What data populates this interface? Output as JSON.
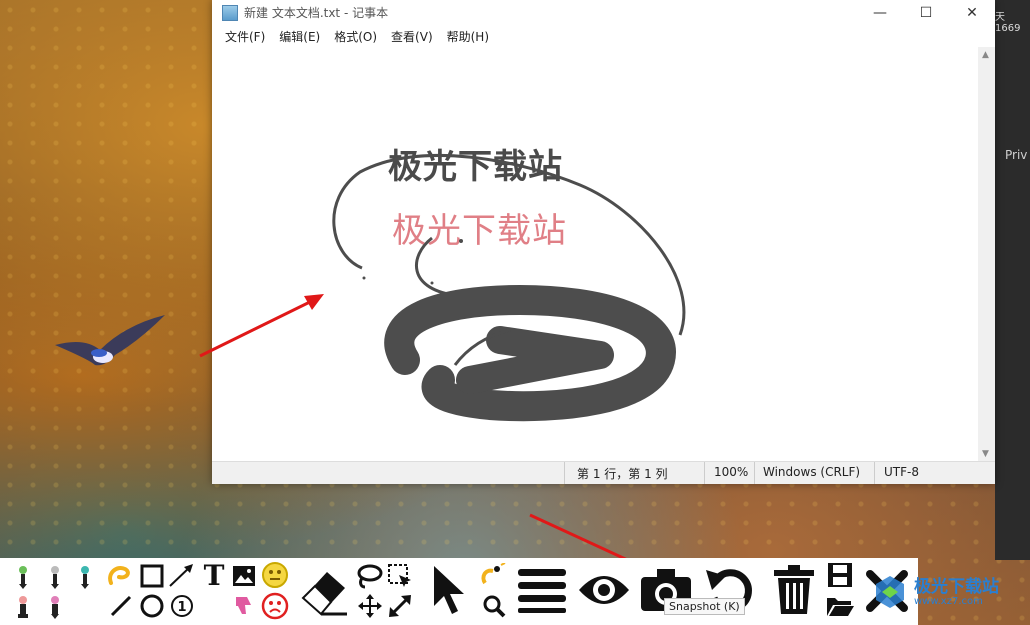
{
  "desktop": {
    "badge": "天 1669",
    "side_label": "Priv"
  },
  "notepad": {
    "title": "新建 文本文档.txt - 记事本",
    "window_buttons": {
      "minimize": "—",
      "maximize": "☐",
      "close": "✕"
    },
    "menu": [
      "文件(F)",
      "编辑(E)",
      "格式(O)",
      "查看(V)",
      "帮助(H)"
    ],
    "content": {
      "line1": "极光下载站",
      "line2": "极光下载站"
    },
    "status": {
      "position": "第 1 行，第 1 列",
      "zoom": "100%",
      "line_ending": "Windows (CRLF)",
      "encoding": "UTF-8"
    }
  },
  "colors": {
    "text1": "#4a4a4a",
    "text2": "#e07f86",
    "ink": "#4d4d4d",
    "arrow": "#e01818",
    "toolbar_bg": "#ffffff"
  },
  "toolbar": {
    "tools": [
      {
        "name": "pen-green-icon"
      },
      {
        "name": "pen-gray-icon"
      },
      {
        "name": "pen-teal-icon"
      },
      {
        "name": "lasso-yellow-icon"
      },
      {
        "name": "rectangle-icon"
      },
      {
        "name": "arrow-line-icon"
      },
      {
        "name": "text-icon"
      },
      {
        "name": "image-icon"
      },
      {
        "name": "smile-emoji-icon"
      },
      {
        "name": "eraser-icon"
      },
      {
        "name": "lasso-icon"
      },
      {
        "name": "select-box-icon"
      },
      {
        "name": "pointer-icon"
      },
      {
        "name": "magic-wand-icon"
      },
      {
        "name": "menu-lines-icon"
      },
      {
        "name": "eye-icon"
      },
      {
        "name": "camera-icon"
      },
      {
        "name": "undo-icon"
      },
      {
        "name": "trash-icon"
      },
      {
        "name": "save-icon"
      },
      {
        "name": "close-x-icon"
      }
    ],
    "text_tool_glyph": "T",
    "counter_glyph": "1",
    "tooltip": "Snapshot (K)"
  },
  "watermark": {
    "text": "极光下载站",
    "sub": "www.xz7.com"
  }
}
